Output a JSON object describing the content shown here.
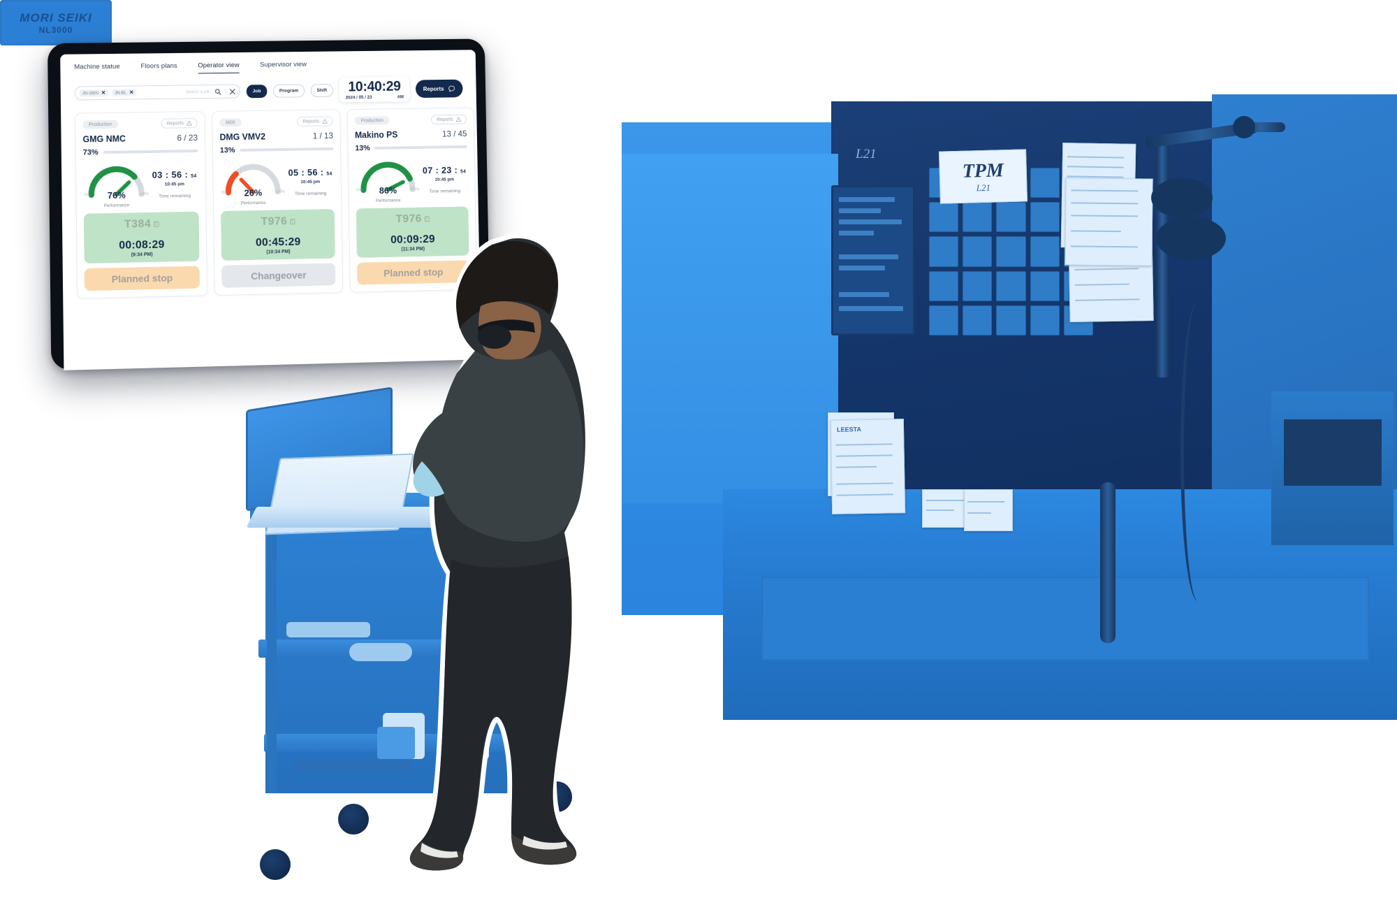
{
  "app": {
    "nav_tabs": [
      {
        "label": "Machine statue",
        "active": false
      },
      {
        "label": "Floors plans",
        "active": false
      },
      {
        "label": "Operator view",
        "active": true
      },
      {
        "label": "Supervisor view",
        "active": false
      }
    ],
    "search": {
      "chips": [
        {
          "label": "JN-3900",
          "remove": "✕"
        },
        {
          "label": "JN-BL",
          "remove": "✕"
        }
      ],
      "placeholder": "Search a job",
      "search_icon": "search-icon",
      "clear_icon": "close-icon",
      "divider": "|"
    },
    "segments": [
      {
        "label": "Job",
        "active": true
      },
      {
        "label": "Program",
        "active": false
      },
      {
        "label": "Shift",
        "active": false
      }
    ],
    "clock": {
      "time": "10:40:29",
      "date": "2024 / 05 / 23",
      "meridiem": "AM"
    },
    "reports_button": {
      "label": "Reports",
      "icon": "chat-bubble-icon"
    }
  },
  "cards": [
    {
      "badge": "Production",
      "reports_label": "Reports",
      "reports_icon": "warning-triangle-icon",
      "title": "GMG NMC",
      "count": "6 / 23",
      "progress_pct_label": "73%",
      "progress_value": 73,
      "gauge": {
        "value_label": "76%",
        "value": 76,
        "caption": "Performance",
        "min_label": "0%",
        "max_label": "100%",
        "color": "#1f9245"
      },
      "timer": {
        "hours": "03",
        "minutes": "56",
        "seconds": "54",
        "at": "10:45 pm",
        "caption": "Time remaining"
      },
      "job": {
        "id": "T384",
        "info_icon": "info-icon",
        "elapsed": "00:08:29",
        "eta": "(9:34 PM)",
        "block_color": "#bfe3c7"
      },
      "status": {
        "label": "Planned stop",
        "type": "planned"
      }
    },
    {
      "badge": "M00",
      "reports_label": "Reports",
      "reports_icon": "warning-triangle-icon",
      "title": "DMG VMV2",
      "count": "1 / 13",
      "progress_pct_label": "13%",
      "progress_value": 13,
      "gauge": {
        "value_label": "26%",
        "value": 26,
        "caption": "Performance",
        "min_label": "0%",
        "max_label": "100%",
        "color": "#f04e23"
      },
      "timer": {
        "hours": "05",
        "minutes": "56",
        "seconds": "54",
        "at": "10:45 pm",
        "caption": "Time remaining"
      },
      "job": {
        "id": "T976",
        "info_icon": "info-icon",
        "elapsed": "00:45:29",
        "eta": "(10:34 PM)",
        "block_color": "#bfe3c7"
      },
      "status": {
        "label": "Changeover",
        "type": "changeover"
      }
    },
    {
      "badge": "Production",
      "reports_label": "Reports",
      "reports_icon": "warning-triangle-icon",
      "title": "Makino PS",
      "count": "13 / 45",
      "progress_pct_label": "13%",
      "progress_value": 13,
      "gauge": {
        "value_label": "86%",
        "value": 86,
        "caption": "Performance",
        "min_label": "0%",
        "max_label": "100%",
        "color": "#1f9245"
      },
      "timer": {
        "hours": "07",
        "minutes": "23",
        "seconds": "54",
        "at": "10:45 pm",
        "caption": "Time remaining"
      },
      "job": {
        "id": "T976",
        "info_icon": "info-icon",
        "elapsed": "00:09:29",
        "eta": "(11:34 PM)",
        "block_color": "#bfe3c7"
      },
      "status": {
        "label": "Planned stop",
        "type": "planned"
      }
    }
  ],
  "scene": {
    "machine_plate_brand": "MORI SEIKI",
    "machine_plate_model": "NL3000",
    "wall_note_title": "TPM",
    "wall_note_sub": "L21",
    "wall_tag": "L21",
    "poster_label": "LEESTA"
  },
  "colors": {
    "brand_navy": "#13294d",
    "green": "#1f9245",
    "orange": "#f04e23",
    "planned_stop_bg": "#fbd9ae",
    "changeover_bg": "#e4e7eb",
    "job_block_bg": "#bfe3c7",
    "photo_blue": "#2f8fe8"
  }
}
